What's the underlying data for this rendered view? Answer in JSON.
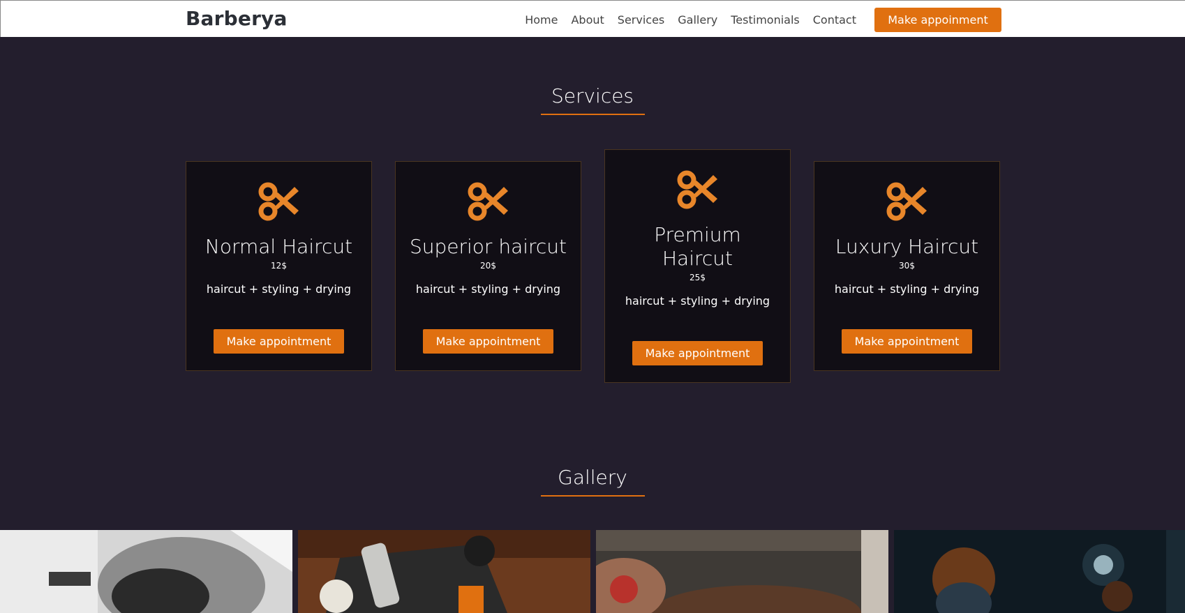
{
  "nav": {
    "brand": "Barberya",
    "links": [
      "Home",
      "About",
      "Services",
      "Gallery",
      "Testimonials",
      "Contact"
    ],
    "cta": "Make appoinment"
  },
  "services": {
    "title": "Services",
    "cards": [
      {
        "name": "Normal Haircut",
        "price": "12$",
        "desc": "haircut + styling + drying",
        "button": "Make appointment"
      },
      {
        "name": "Superior haircut",
        "price": "20$",
        "desc": "haircut + styling + drying",
        "button": "Make appointment"
      },
      {
        "name": "Premium Haircut",
        "price": "25$",
        "desc": "haircut + styling + drying",
        "button": "Make appointment"
      },
      {
        "name": "Luxury Haircut",
        "price": "30$",
        "desc": "haircut + styling + drying",
        "button": "Make appointment"
      }
    ]
  },
  "gallery": {
    "title": "Gallery"
  },
  "colors": {
    "accent": "#e07010",
    "background": "#231e2d",
    "card": "#110e15"
  }
}
